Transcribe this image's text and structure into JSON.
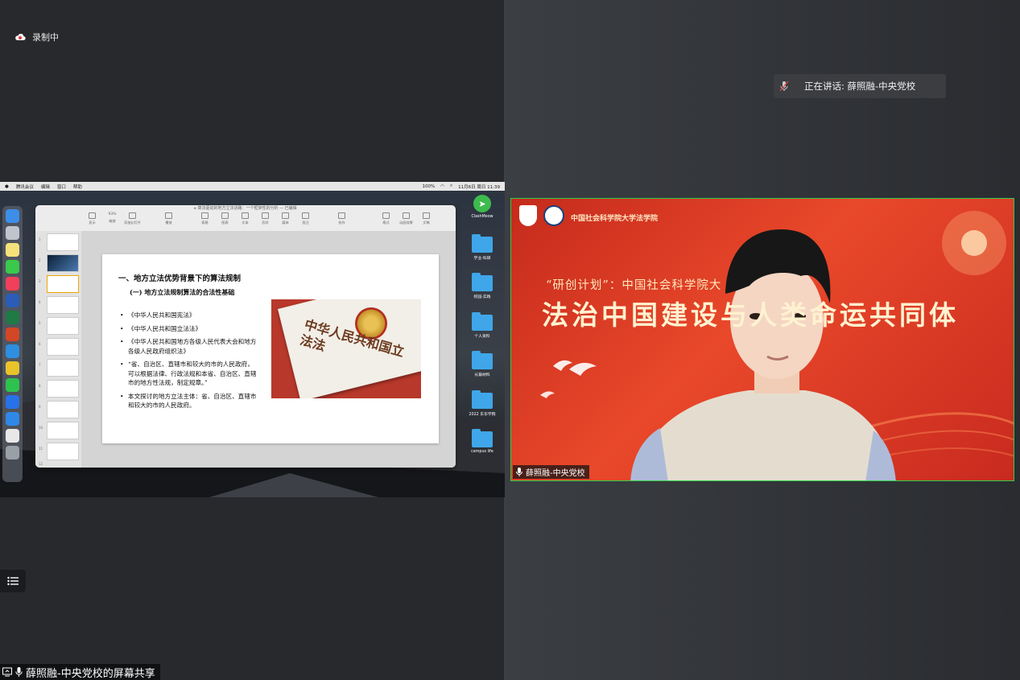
{
  "recording": {
    "label": "录制中"
  },
  "speaking": {
    "text": "正在讲话: 薛照融-中央党校"
  },
  "mac_menubar": {
    "items": [
      "腾讯会议",
      "编辑",
      "窗口",
      "帮助"
    ],
    "battery": "100%",
    "datetime": "11月6日 周日 11:39"
  },
  "desktop": {
    "items": [
      "ClashMeow",
      "学业-科研",
      "校园-实践",
      "个人资料",
      "长篇材料",
      "2022 东华学院",
      "campus life"
    ]
  },
  "ppt": {
    "window_title": "▸ 算法驱动的地方立法进路：一个框架性的分析 — 已编辑",
    "zoom": "93%",
    "toolbar": [
      "显示",
      "缩放",
      "添加幻灯片",
      "播放",
      "表格",
      "图表",
      "文本",
      "形状",
      "媒体",
      "批注",
      "协作",
      "格式",
      "动画效果",
      "文稿"
    ],
    "thumb_numbers": [
      "1",
      "2",
      "3",
      "4",
      "5",
      "6",
      "7",
      "8",
      "9",
      "10",
      "11",
      "12"
    ],
    "slide": {
      "heading": "一、地方立法优势背景下的算法规制",
      "subheading": "(一) 地方立法规制算法的合法性基础",
      "bullets": [
        "《中华人民共和国宪法》",
        "《中华人民共和国立法法》",
        "《中华人民共和国地方各级人民代表大会和地方各级人民政府组织法》",
        "“省、自治区、直辖市和较大的市的人民政府，可以根据法律、行政法规和本省、自治区、直辖市的地方性法规，制定规章。”",
        "本文探讨的地方立法主体：省、自治区、直辖市和较大的市的人民政府。"
      ],
      "image_text": "中华人民共和国立法法"
    }
  },
  "video": {
    "logo_text": "中国社会科学院大学法学院",
    "banner_sub": "“研创计划”：中国社会科学院大",
    "banner_main": "法治中国建设与人类命运共同体",
    "participant": "薛照融-中央党校"
  },
  "share_label": "薛照融-中央党校的屏幕共享",
  "colors": {
    "accent_green": "#2ecc4a",
    "recording_red": "#e03a3a",
    "banner_red": "#d43a22"
  }
}
